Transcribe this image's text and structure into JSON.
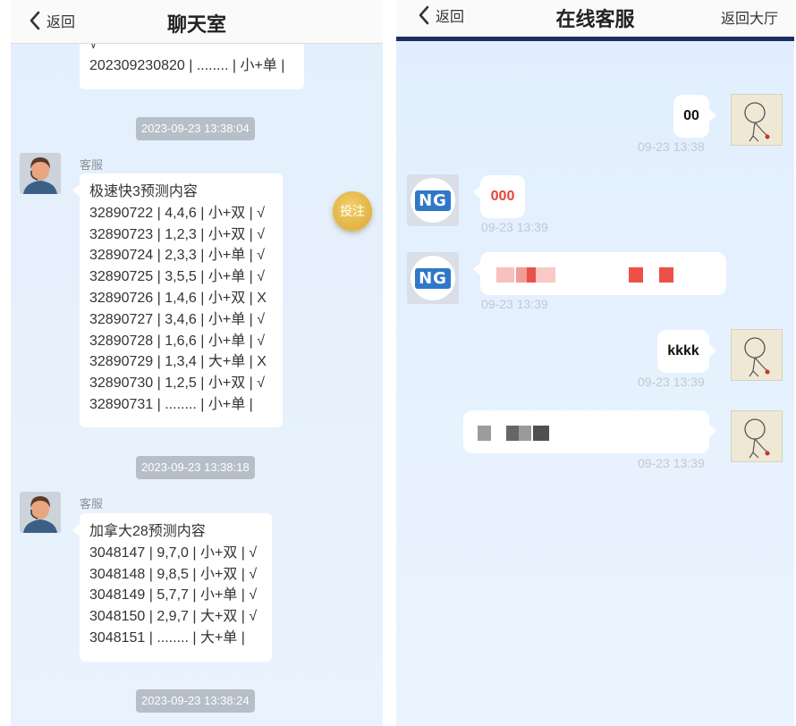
{
  "left": {
    "back_label": "返回",
    "title": "聊天室",
    "bet_label": "投注",
    "partial": {
      "lines": [
        "√",
        "202309230820 | ........ | 小+单 |"
      ]
    },
    "messages": [
      {
        "time": "2023-09-23 13:38:04",
        "sender": "客服",
        "lines": [
          "极速快3预测内容",
          "32890722 | 4,4,6 | 小+双 | √",
          "32890723 | 1,2,3 | 小+双 | √",
          "32890724 | 2,3,3 | 小+单 | √",
          "32890725 | 3,5,5 | 小+单 | √",
          "32890726 | 1,4,6 | 小+双 | X",
          "32890727 | 3,4,6 | 小+单 | √",
          "32890728 | 1,6,6 | 小+单 | √",
          "32890729 | 1,3,4 | 大+单 | X",
          "32890730 | 1,2,5 | 小+双 | √",
          "32890731 | ........ | 小+单 |"
        ]
      },
      {
        "time": "2023-09-23 13:38:18",
        "sender": "客服",
        "lines": [
          "加拿大28预测内容",
          "3048147 | 9,7,0 | 小+双 | √",
          "3048148 | 9,8,5 | 小+双 | √",
          "3048149 | 5,7,7 | 小+单 | √",
          "3048150 | 2,9,7 | 大+双 | √",
          "3048151 | ........ | 大+单 |"
        ]
      }
    ],
    "last_time": "2023-09-23 13:38:24"
  },
  "right": {
    "back_label": "返回",
    "title": "在线客服",
    "hall_label": "返回大厅",
    "ng_logo": "NG",
    "messages": [
      {
        "side": "right",
        "text": "00",
        "time": "09-23 13:38"
      },
      {
        "side": "left",
        "text": "000",
        "color": "#e8423c",
        "time": "09-23 13:39"
      },
      {
        "side": "left",
        "text": "",
        "time": "09-23 13:39"
      },
      {
        "side": "right",
        "text": "kkkk",
        "time": "09-23 13:39"
      },
      {
        "side": "right",
        "text": "",
        "time": "09-23 13:39"
      }
    ]
  }
}
